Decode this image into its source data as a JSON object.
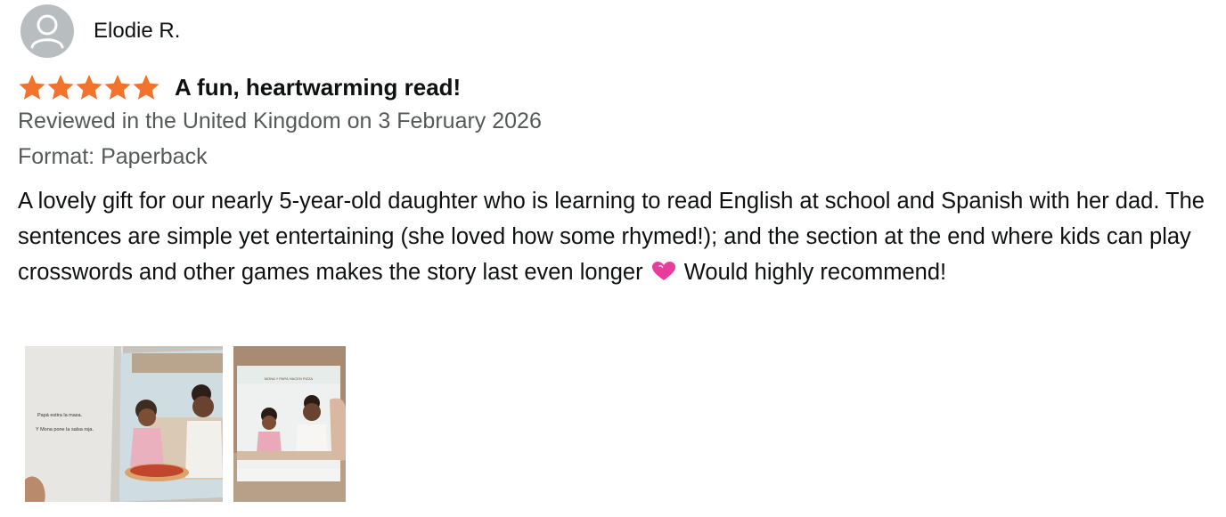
{
  "reviewer": {
    "name": "Elodie R.",
    "avatar_icon": "default-user-avatar-icon"
  },
  "rating": {
    "stars": 5,
    "max": 5,
    "star_color": "#f3722c"
  },
  "review": {
    "title": "A fun, heartwarming read!",
    "meta_date": "Reviewed in the United Kingdom on 3 February 2026",
    "meta_format": "Format: Paperback",
    "body_before_emoji": "A lovely gift for our nearly 5-year-old daughter who is learning to read English at school and Spanish with her dad. The sentences are simple yet entertaining (she loved how some rhymed!); and the section at the end where kids can play crosswords and other games makes the story last even longer",
    "emoji_icon": "pink-heart-icon",
    "body_after_emoji": "Would highly recommend!"
  },
  "photos": [
    {
      "name": "review-photo-1",
      "line_1": "Papá estira la masa.",
      "line_2": "Y Mona pone la salsa roja."
    },
    {
      "name": "review-photo-2",
      "cover_title": "MONA Y PAPÁ HACEN PIZZA"
    }
  ],
  "colors": {
    "text": "#0f1111",
    "meta": "#565959",
    "avatar_bg": "#b8bdc0"
  }
}
